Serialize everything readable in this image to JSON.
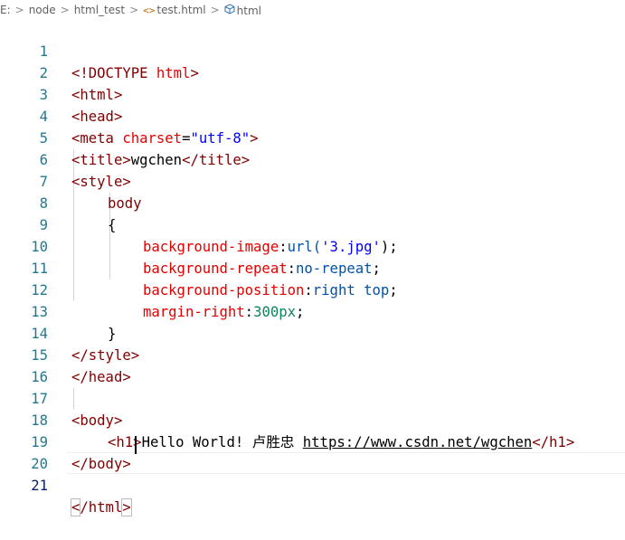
{
  "breadcrumb": {
    "drive": "E:",
    "folder1": "node",
    "folder2": "html_test",
    "file": "test.html",
    "symbol": "html",
    "separator": ">"
  },
  "editor": {
    "line_numbers": [
      "1",
      "2",
      "3",
      "4",
      "5",
      "6",
      "7",
      "8",
      "9",
      "10",
      "11",
      "12",
      "13",
      "14",
      "15",
      "16",
      "17",
      "18",
      "19",
      "20",
      "21"
    ],
    "tokens": {
      "l1_a": "<!DOCTYPE",
      "l1_b": "html",
      "l1_c": ">",
      "l2": "<html>",
      "l3": "<head>",
      "l4_a": "<meta",
      "l4_b": "charset",
      "l4_c": "=",
      "l4_d": "\"utf-8\"",
      "l4_e": ">",
      "l5_a": "<title>",
      "l5_b": "wgchen",
      "l5_c": "</title>",
      "l6": "<style>",
      "l7": "body",
      "l8": "{",
      "l9_a": "background-image",
      "l9_b": ":",
      "l9_c": "url(",
      "l9_d": "'3.jpg'",
      "l9_e": ");",
      "l10_a": "background-repeat",
      "l10_b": ":",
      "l10_c": "no-repeat",
      "l10_d": ";",
      "l11_a": "background-position",
      "l11_b": ":",
      "l11_c": "right top",
      "l11_d": ";",
      "l12_a": "margin-right",
      "l12_b": ":",
      "l12_c": "300px",
      "l12_d": ";",
      "l13": "}",
      "l14": "</style>",
      "l15": "</head>",
      "l17": "<body>",
      "l18_a": "<h1>",
      "l18_b": "Hello World! 卢胜忠 ",
      "l18_c": "https://www.csdn.net/wgchen",
      "l18_d": "</h1>",
      "l19": "</body>",
      "l21_a": "<",
      "l21_b": "/html",
      "l21_c": ">"
    }
  },
  "colors": {
    "tag": "#800000",
    "attribute": "#e50000",
    "string": "#0000ff",
    "css_value": "#0451a5",
    "number": "#098658",
    "line_number": "#237893"
  }
}
